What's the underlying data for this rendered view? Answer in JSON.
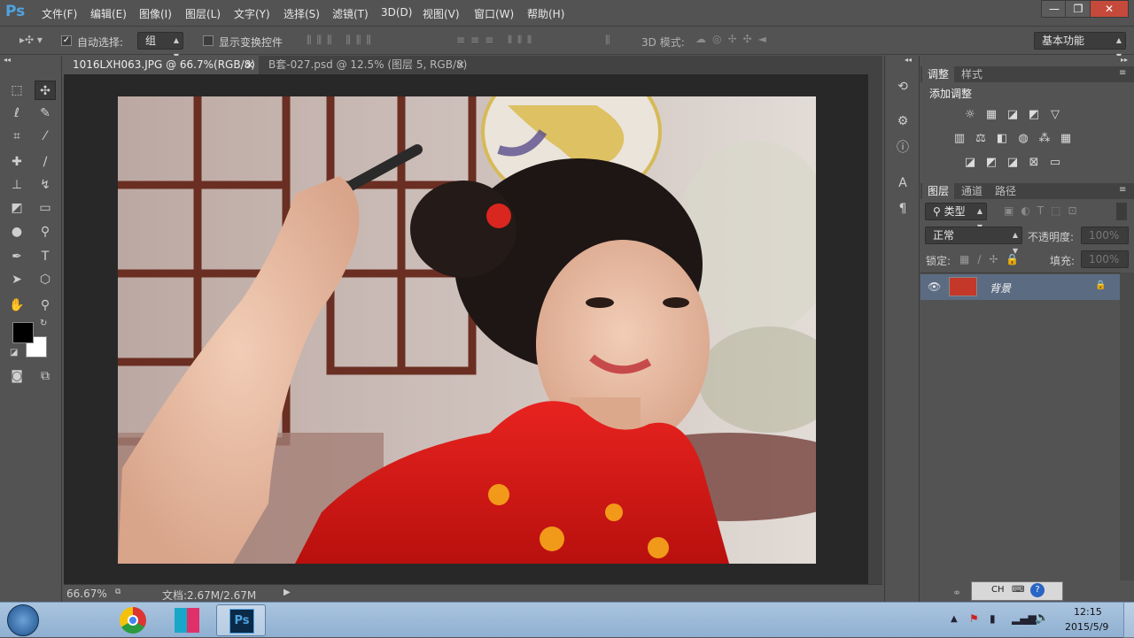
{
  "app": {
    "logo": "Ps",
    "menu": [
      "文件(F)",
      "编辑(E)",
      "图像(I)",
      "图层(L)",
      "文字(Y)",
      "选择(S)",
      "滤镜(T)",
      "3D(D)",
      "视图(V)",
      "窗口(W)",
      "帮助(H)"
    ],
    "window_buttons": {
      "minimize": "—",
      "restore": "❐",
      "close": "✕"
    }
  },
  "options_bar": {
    "auto_select_label": "自动选择:",
    "auto_select_checked": true,
    "auto_select_value": "组",
    "show_transform_label": "显示变换控件",
    "show_transform_checked": false,
    "mode_3d_label": "3D 模式:",
    "workspace": "基本功能"
  },
  "tabs": [
    {
      "label": "1016LXH063.JPG @ 66.7%(RGB/8)",
      "close": "×",
      "active": true
    },
    {
      "label": "B套-027.psd @ 12.5% (图层 5, RGB/8)",
      "close": "×",
      "active": false
    }
  ],
  "status": {
    "zoom": "66.67%",
    "doc_size": "文档:2.67M/2.67M"
  },
  "adjustments_panel": {
    "tabs": [
      "调整",
      "样式"
    ],
    "title": "添加调整"
  },
  "layers_panel": {
    "tabs": [
      "图层",
      "通道",
      "路径"
    ],
    "filter_kind": "类型",
    "blend_mode": "正常",
    "opacity_label": "不透明度:",
    "opacity_value": "100%",
    "lock_label": "锁定:",
    "fill_label": "填充:",
    "fill_value": "100%",
    "layers": [
      {
        "name": "背景",
        "visible": true,
        "locked": true
      }
    ]
  },
  "taskbar": {
    "language": "CH",
    "time": "12:15",
    "date": "2015/5/9"
  },
  "colors": {
    "foreground": "#000000",
    "background": "#ffffff",
    "ui_gray": "#535353",
    "canvas_bg": "#282828",
    "selected_layer": "#5a6a80"
  }
}
